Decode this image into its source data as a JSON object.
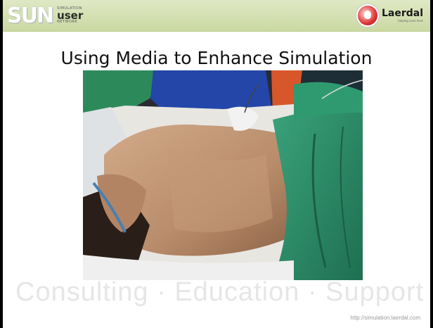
{
  "header": {
    "sun_logo": {
      "letters": "SUN",
      "line_top": "SIMULATION",
      "line_mid": "user",
      "line_bottom": "NETWORK"
    },
    "laerdal_logo": {
      "name": "Laerdal",
      "tagline": "helping save lives"
    }
  },
  "slide": {
    "title": "Using Media to Enhance Simulation",
    "image_description": "Photo of a patient lying on an operating table under green surgical drapes",
    "footer_tagline": "Consulting · Education · Support",
    "footer_url": "http://simulation.laerdal.com"
  },
  "colors": {
    "header_bg": "#d6e2b4",
    "drape_green": "#2f8f6a",
    "skin": "#c49a78"
  }
}
